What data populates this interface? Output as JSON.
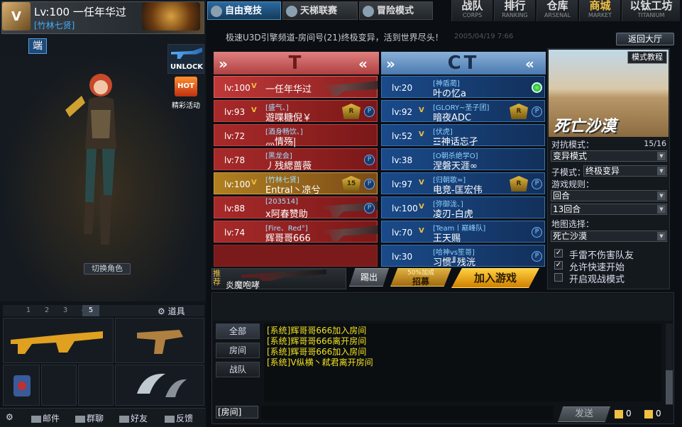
{
  "profile": {
    "rank_badge": "V",
    "level_name": "Lv:100 一任年华过",
    "clan": "[竹林七贤]"
  },
  "left": {
    "duan": "端",
    "unlock": "UNLOCK",
    "hot_icon": "HOT",
    "hot_label": "精彩活动",
    "switch_role": "切换角色",
    "item_tabs": [
      "1",
      "2",
      "3",
      "4",
      "5"
    ],
    "active_tab": "5",
    "props": "道具",
    "bottom": {
      "mail": "邮件",
      "group": "群聊",
      "friends": "好友",
      "feedback": "反馈"
    }
  },
  "tabs": {
    "free": "自由竞技",
    "ladder": "天梯联赛",
    "adventure": "冒险模式"
  },
  "nav": [
    {
      "cn": "战队",
      "en": "CORPS"
    },
    {
      "cn": "排行",
      "en": "RANKING"
    },
    {
      "cn": "仓库",
      "en": "ARSENAL"
    },
    {
      "cn": "商城",
      "en": "MARKET"
    },
    {
      "cn": "以钛工坊",
      "en": "TITANIUM"
    }
  ],
  "room": {
    "announce": "极速U3D引擎频道-房间号(21)终极变异，活到世界尽头！",
    "timestamp": "2005/04/19 7:66",
    "back": "返回大厅"
  },
  "teams": {
    "t_label": "T",
    "ct_label": "CT",
    "t_rows": [
      {
        "lv": "lv:100",
        "vc": "V",
        "clan": "",
        "name": "一任年华过"
      },
      {
        "lv": "lv:93",
        "vc": "V",
        "clan": "[盛气、]",
        "name": "遊喋糖倪￥",
        "rank": "R",
        "p": "P"
      },
      {
        "lv": "lv:72",
        "vc": "",
        "clan": "[酒身畅饮、]",
        "name": "灬情殇|"
      },
      {
        "lv": "lv:78",
        "vc": "",
        "clan": "[黑龙会]",
        "name": "丿残緦蔷薇",
        "p": "P"
      },
      {
        "lv": "lv:100",
        "vc": "V",
        "clan": "[竹林七贤]",
        "name": "Entral丶凉兮",
        "rank": "15",
        "p": "P"
      },
      {
        "lv": "lv:88",
        "vc": "",
        "clan": "[203514]",
        "name": "x阿春赞助",
        "p": "P"
      },
      {
        "lv": "lv:74",
        "vc": "",
        "clan": "[Fire、Red°]",
        "name": "辉哥哥666"
      }
    ],
    "ct_rows": [
      {
        "lv": "lv:20",
        "vc": "",
        "clan": "[神盾蔺]",
        "name": "叶の忆a"
      },
      {
        "lv": "lv:92",
        "vc": "V",
        "clan": "[GLORY~圣子团]",
        "name": "暗夜ADC",
        "rank": "R",
        "p": "P"
      },
      {
        "lv": "lv:52",
        "vc": "V",
        "clan": "[伏虎]",
        "name": "☲神话忘孑"
      },
      {
        "lv": "lv:38",
        "vc": "",
        "clan": "[O朝杀绝学O]",
        "name": "涅磐天涯∞"
      },
      {
        "lv": "lv:97",
        "vc": "V",
        "clan": "[归朝歌≈]",
        "name": "电竞-匡宏伟",
        "rank": "R",
        "p": "P"
      },
      {
        "lv": "lv:100",
        "vc": "V",
        "clan": "[弥御泷、]",
        "name": "凌刃-白虎"
      },
      {
        "lv": "lv:70",
        "vc": "V",
        "clan": "[Team丨巅峰队]",
        "name": "王天赐",
        "p": "P"
      },
      {
        "lv": "lv:30",
        "vc": "",
        "clan": "[哈神vs笙哥]",
        "name": "习惯╜残洸",
        "p": "P"
      }
    ]
  },
  "recommend": {
    "label": "推荐",
    "weapon_name": "炎魔咆哮"
  },
  "buttons": {
    "out": "踢出",
    "recruit_small": "50%加成",
    "recruit": "招募",
    "join": "加入游戏"
  },
  "mode": {
    "tutorial": "模式教程",
    "map_title": "死亡沙漠",
    "battle_label": "对抗模式：",
    "battle_count": "15/16",
    "battle_value": "变异模式",
    "sub_label": "子模式：",
    "sub_value": "终极变异",
    "rules_label": "游戏规则：",
    "rules_value": "回合",
    "rounds_value": "13回合",
    "map_label": "地图选择：",
    "map_value": "死亡沙漠",
    "opt1": "手雷不伤害队友",
    "opt2": "允许快速开始",
    "opt3": "开启观战模式",
    "opt1_checked": "✓",
    "opt2_checked": "✓"
  },
  "chat": {
    "tabs": [
      "全部",
      "房间",
      "战队"
    ],
    "messages": [
      "[系统]辉哥哥666加入房间",
      "[系统]辉哥哥666离开房间",
      "[系统]辉哥哥666加入房间",
      "[系统]V纵横丶弒君离开房间"
    ],
    "channel": "[房间]",
    "send": "发送",
    "count1": "0",
    "count2": "0"
  },
  "colors": {
    "accent": "#2a6aa0",
    "t_team": "#a82a2a",
    "ct_team": "#1a4a8a",
    "system_msg": "#f0e020"
  }
}
